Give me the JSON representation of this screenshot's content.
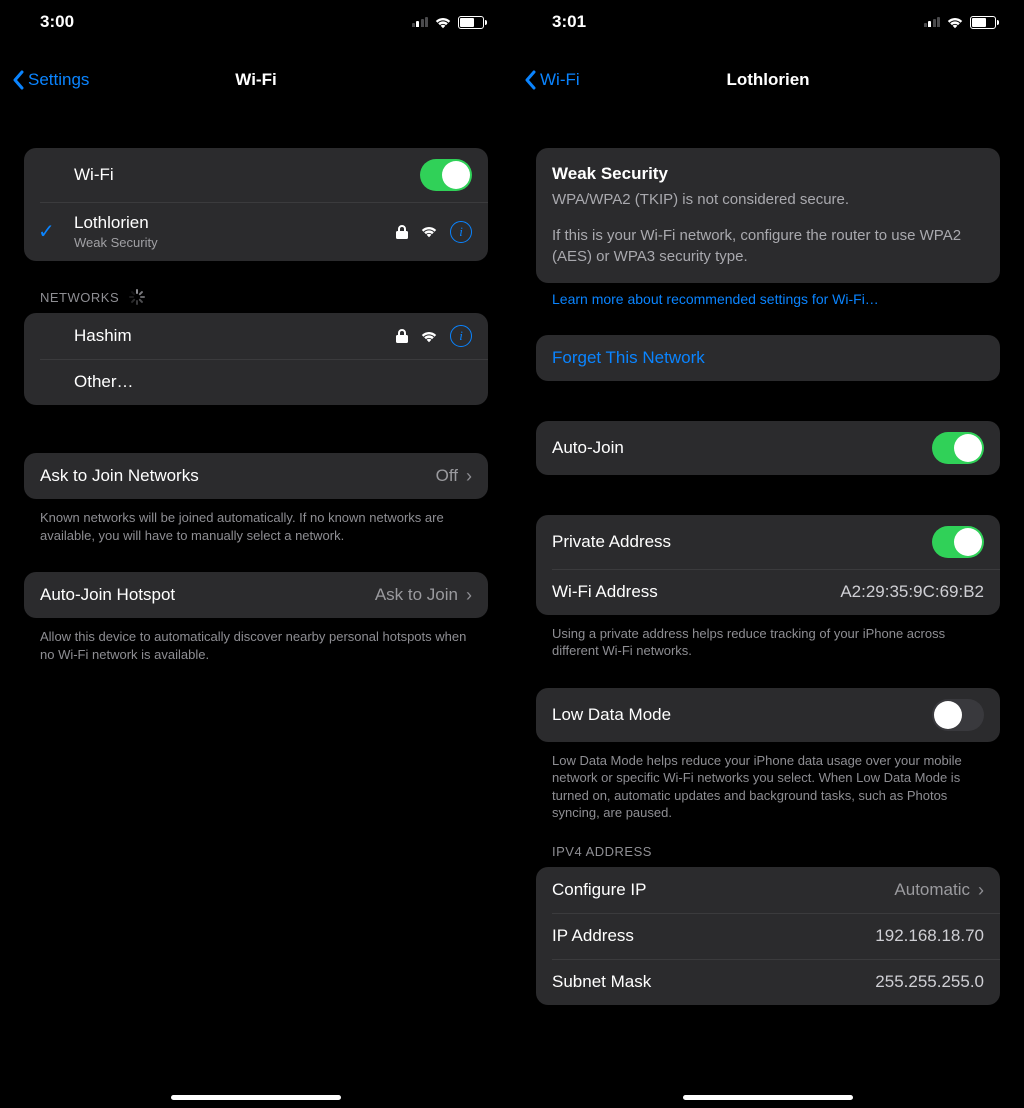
{
  "left": {
    "time": "3:00",
    "back": "Settings",
    "title": "Wi-Fi",
    "wifi_toggle_label": "Wi-Fi",
    "wifi_toggle_on": true,
    "connected": {
      "name": "Lothlorien",
      "warning": "Weak Security"
    },
    "networks_header": "NETWORKS",
    "networks": [
      {
        "name": "Hashim"
      }
    ],
    "other_label": "Other…",
    "ask_join": {
      "label": "Ask to Join Networks",
      "value": "Off"
    },
    "ask_join_footer": "Known networks will be joined automatically. If no known networks are available, you will have to manually select a network.",
    "auto_hotspot": {
      "label": "Auto-Join Hotspot",
      "value": "Ask to Join"
    },
    "auto_hotspot_footer": "Allow this device to automatically discover nearby personal hotspots when no Wi-Fi network is available."
  },
  "right": {
    "time": "3:01",
    "back": "Wi-Fi",
    "title": "Lothlorien",
    "weak_security": {
      "heading": "Weak Security",
      "line1": "WPA/WPA2 (TKIP) is not considered secure.",
      "line2": "If this is your Wi-Fi network, configure the router to use WPA2 (AES) or WPA3 security type."
    },
    "learn_more": "Learn more about recommended settings for Wi-Fi…",
    "forget_label": "Forget This Network",
    "auto_join_label": "Auto-Join",
    "private_address_label": "Private Address",
    "wifi_address": {
      "label": "Wi-Fi Address",
      "value": "A2:29:35:9C:69:B2"
    },
    "private_footer": "Using a private address helps reduce tracking of your iPhone across different Wi-Fi networks.",
    "low_data_label": "Low Data Mode",
    "low_data_footer": "Low Data Mode helps reduce your iPhone data usage over your mobile network or specific Wi-Fi networks you select. When Low Data Mode is turned on, automatic updates and background tasks, such as Photos syncing, are paused.",
    "ipv4_header": "IPV4 ADDRESS",
    "configure_ip": {
      "label": "Configure IP",
      "value": "Automatic"
    },
    "ip_address": {
      "label": "IP Address",
      "value": "192.168.18.70"
    },
    "subnet_mask": {
      "label": "Subnet Mask",
      "value": "255.255.255.0"
    }
  }
}
